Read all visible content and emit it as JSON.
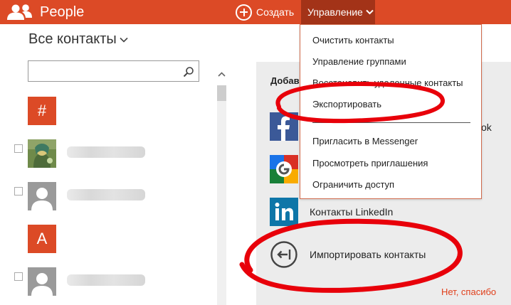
{
  "header": {
    "app_title": "People",
    "app_icon": "people-icon",
    "create_label": "Создать",
    "create_icon": "plus-circle-icon",
    "manage_label": "Управление",
    "accent_color": "#dc4a26",
    "manage_active_color": "#a33318"
  },
  "contacts": {
    "heading": "Все контакты",
    "search_placeholder": "",
    "search_icon": "search-icon",
    "groups": [
      {
        "letter": "#",
        "entries": [
          {
            "avatar": "photo-avatar"
          },
          {
            "avatar": "default-avatar"
          }
        ]
      },
      {
        "letter": "А",
        "entries": [
          {
            "avatar": "default-avatar"
          }
        ]
      }
    ]
  },
  "panel": {
    "heading": "Добавить",
    "peek_text": "ok",
    "services": [
      {
        "label": "",
        "icon": "facebook-logo"
      },
      {
        "label": "",
        "icon": "google-logo"
      },
      {
        "label": "Контакты LinkedIn",
        "icon": "linkedin-logo"
      },
      {
        "label": "Импортировать контакты",
        "icon": "import-icon"
      }
    ],
    "no_thanks": "Нет, спасибо"
  },
  "menu": {
    "items": [
      "Очистить контакты",
      "Управление группами",
      "Восстановить удаленные контакты",
      "Экспортировать",
      "Пригласить в Messenger",
      "Просмотреть приглашения",
      "Ограничить доступ"
    ]
  },
  "annotations": {
    "color": "#e8000a",
    "highlighted": [
      "Экспортировать",
      "Импортировать контакты"
    ]
  }
}
